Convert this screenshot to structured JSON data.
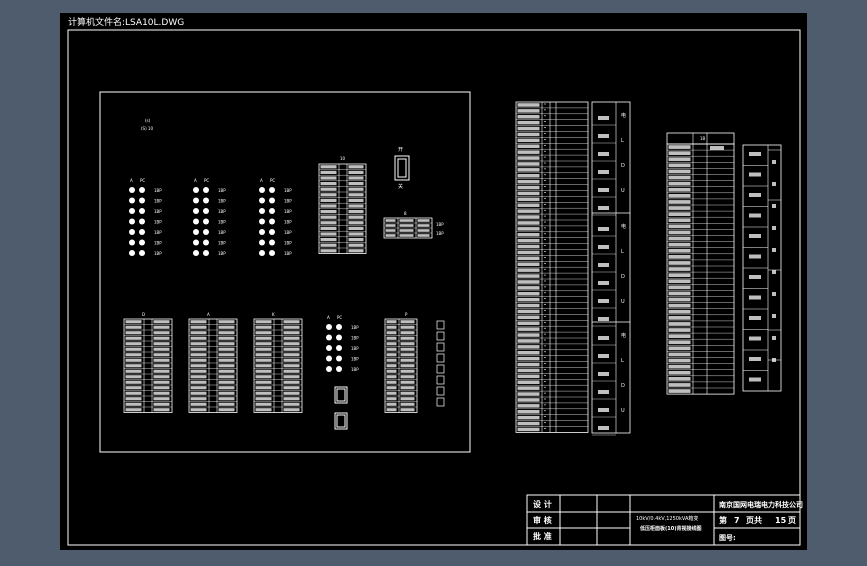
{
  "window": {
    "file_title": "计算机文件名:LSA10L.DWG",
    "bg_color": "#4f5c6e",
    "sheet_color": "#000000",
    "line_color": "#ffffff"
  },
  "panel": {
    "top_note": "(s)\n(S) 10",
    "led_col_labels": [
      "A",
      "PC"
    ],
    "led_row_label": "1BP",
    "switch_label_top": "开",
    "switch_label_bottom": "关",
    "mid_table_title": "10",
    "side_table_title": "8",
    "bottom_group_titles": [
      "D",
      "A",
      "K",
      "P"
    ],
    "cell_text": "1BP"
  },
  "right_tables": {
    "left_col_text": "1BP-1",
    "mid_col_text": "1BP",
    "mid_side_chars": [
      "电",
      "L",
      "D",
      "U"
    ],
    "small_table_title": "1B",
    "narrow_col_text": "开关"
  },
  "title_block": {
    "rows": [
      "设 计",
      "审 核",
      "批 准"
    ],
    "project_line1": "10kV/0.4kV,1250kVA箱变",
    "project_line2": "低压柜面板(10)背视接线图",
    "company": "南京国网电瑞电力科技公司",
    "sheet_label_a": "第",
    "sheet_no": "7",
    "sheet_label_b": "页共",
    "sheet_total": "15",
    "sheet_label_c": "页",
    "drawing_no_label": "图号:"
  }
}
